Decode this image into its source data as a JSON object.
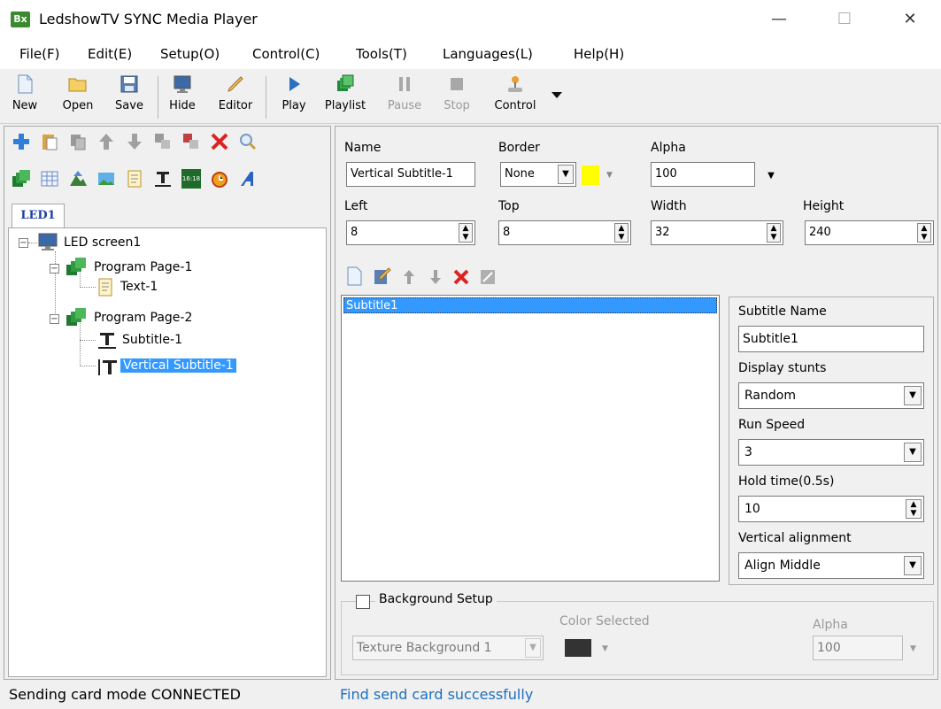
{
  "window": {
    "title": "LedshowTV SYNC Media Player",
    "app_icon_text": "Bx",
    "minimize": "—",
    "maximize": "☐",
    "close": "✕"
  },
  "menu": [
    "File(F)",
    "Edit(E)",
    "Setup(O)",
    "Control(C)",
    "Tools(T)",
    "Languages(L)",
    "Help(H)"
  ],
  "toolbar": {
    "new": "New",
    "open": "Open",
    "save": "Save",
    "hide": "Hide",
    "editor": "Editor",
    "play": "Play",
    "playlist": "Playlist",
    "pause": "Pause",
    "stop": "Stop",
    "control": "Control"
  },
  "left": {
    "tab": "LED1",
    "tree": {
      "screen": "LED screen1",
      "page1": "Program Page-1",
      "text1": "Text-1",
      "page2": "Program Page-2",
      "subtitle1": "Subtitle-1",
      "vsubtitle1": "Vertical Subtitle-1"
    },
    "clock_icon_text": "16:18"
  },
  "props": {
    "name_label": "Name",
    "name_value": "Vertical Subtitle-1",
    "border_label": "Border",
    "border_value": "None",
    "border_color": "#ffff00",
    "alpha_label": "Alpha",
    "alpha_value": "100",
    "left_label": "Left",
    "left_value": "8",
    "top_label": "Top",
    "top_value": "8",
    "width_label": "Width",
    "width_value": "32",
    "height_label": "Height",
    "height_value": "240"
  },
  "subtitle_list": [
    "Subtitle1"
  ],
  "subtitle_props": {
    "name_label": "Subtitle Name",
    "name_value": "Subtitle1",
    "stunts_label": "Display stunts",
    "stunts_value": "Random",
    "speed_label": "Run Speed",
    "speed_value": "3",
    "hold_label": "Hold time(0.5s)",
    "hold_value": "10",
    "valign_label": "Vertical alignment",
    "valign_value": "Align Middle"
  },
  "background": {
    "title": "Background Setup",
    "checked": false,
    "texture_value": "Texture Background 1",
    "color_label": "Color Selected",
    "color_value": "#333333",
    "alpha_label": "Alpha",
    "alpha_value": "100"
  },
  "status": {
    "left": "Sending card mode CONNECTED",
    "right": "Find send card successfully"
  }
}
